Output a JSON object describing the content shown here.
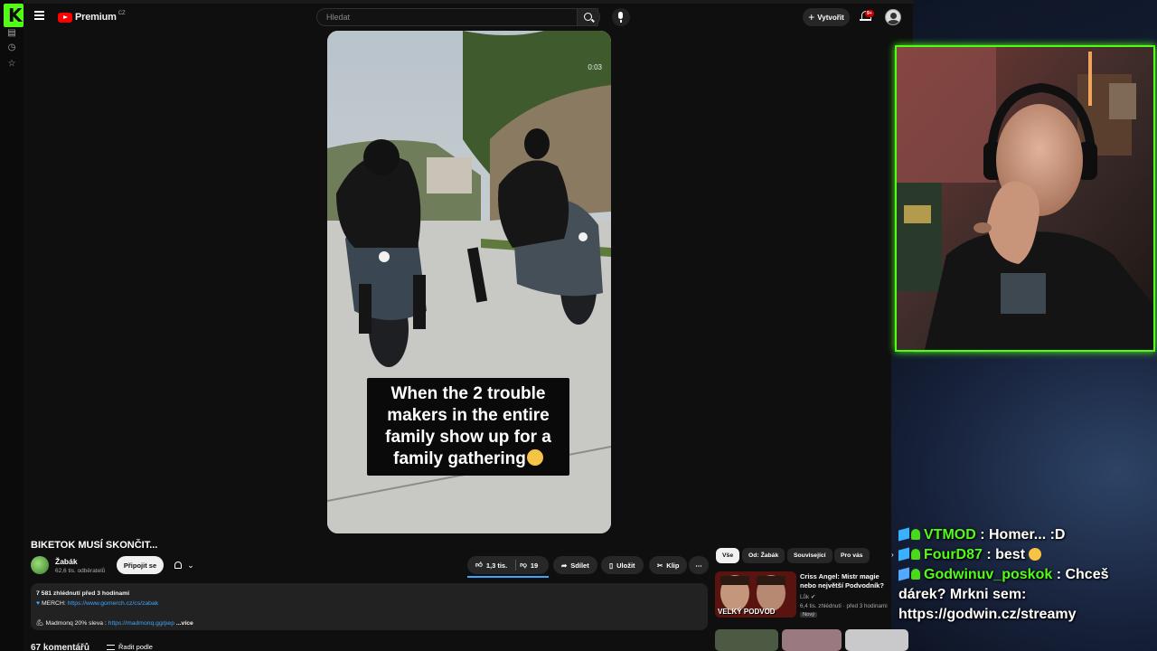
{
  "youtube": {
    "logo_text": "Premium",
    "logo_country": "CZ",
    "search_placeholder": "Hledat",
    "create_label": "Vytvořit",
    "notifications_badge": "9+"
  },
  "video": {
    "timestamp": "0:03",
    "caption": "When the 2 trouble makers in the entire family show up for a family gathering",
    "title": "BIKETOK MUSÍ SKONČIT...",
    "channel_name": "Žabák",
    "channel_subs": "62,6 tis. odběratelů",
    "join_label": "Připojit se",
    "likes": "1,3 tis.",
    "dislikes": "19",
    "share_label": "Sdílet",
    "save_label": "Uložit",
    "clip_label": "Klip",
    "more_label": "⋯"
  },
  "description": {
    "views": "7 581 zhlédnutí",
    "time_ago": "před 3 hodinami",
    "merch_label": "MERCH:",
    "merch_link": "https://www.gomerch.cz/cs/zabak",
    "promo_label": "Madmonq 20% sleva :",
    "promo_link": "https://madmonq.gg/pep",
    "more_label": "...více"
  },
  "comments": {
    "count_label": "67 komentářů",
    "sort_label": "Řadit podle"
  },
  "recommendations": {
    "chips": [
      "Vše",
      "Od: Žabák",
      "Související",
      "Pro vás"
    ],
    "items": [
      {
        "title": "Criss Angel: Mistr magie nebo největší Podvodník?",
        "channel": "Lůk",
        "meta": "6,4 tis. zhlédnutí · před 3 hodinami",
        "badge": "Nový",
        "thumb_text": "VELKÝ PODVOD"
      }
    ]
  },
  "chat": {
    "messages": [
      {
        "user": "VTMOD",
        "text": "Homer... :D",
        "color": "#53fc18"
      },
      {
        "user": "FourD87",
        "text": "best",
        "color": "#53fc18"
      },
      {
        "user": "Godwinuv_poskok",
        "text": "Chceš dárek? Mrkni sem: https://godwin.cz/streamy",
        "color": "#53fc18"
      }
    ]
  },
  "colors": {
    "kick_green": "#53fc18",
    "youtube_red": "#ff0000",
    "link_blue": "#3ea6ff"
  }
}
